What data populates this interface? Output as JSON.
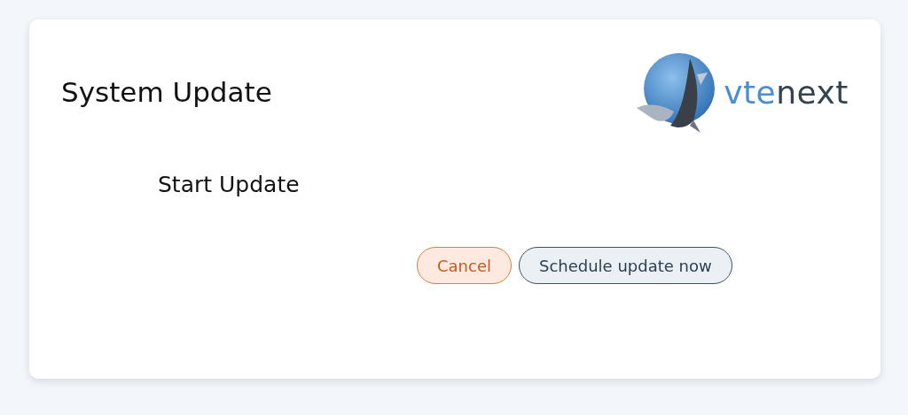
{
  "dialog": {
    "title": "System Update",
    "logo": {
      "parts": [
        {
          "text": "vte",
          "color": "#4a8fcf"
        },
        {
          "text": "next",
          "color": "#34434f"
        }
      ]
    },
    "message": "Start Update",
    "buttons": [
      {
        "label": "Cancel",
        "kind": "cancel"
      },
      {
        "label": "Schedule update now",
        "kind": "primary"
      }
    ]
  }
}
